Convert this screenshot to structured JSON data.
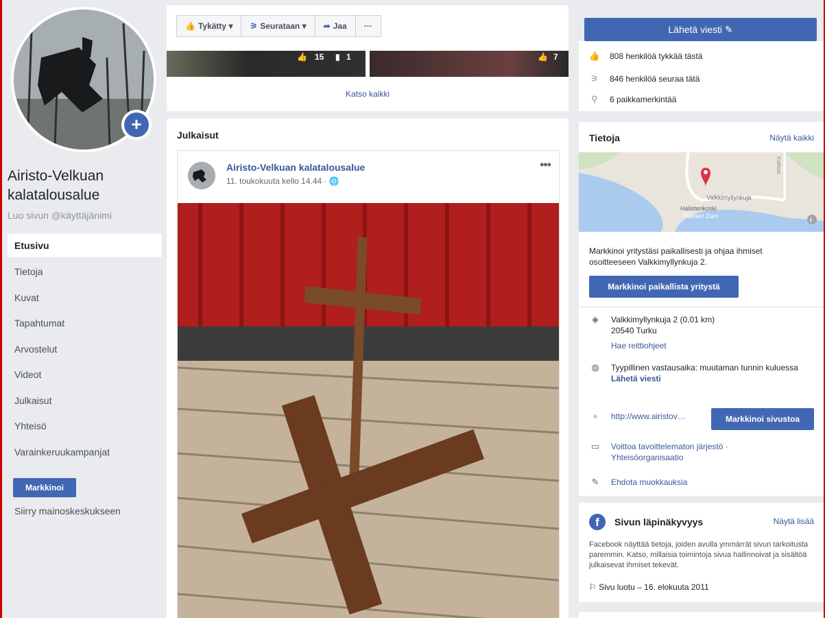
{
  "page": {
    "name": "Airisto-Velkuan kalatalousalue",
    "username_cta": "Luo sivun @käyttäjänimi"
  },
  "nav": {
    "items": [
      "Etusivu",
      "Tietoja",
      "Kuvat",
      "Tapahtumat",
      "Arvostelut",
      "Videot",
      "Julkaisut",
      "Yhteisö",
      "Varainkeruukampanjat"
    ],
    "active": "Etusivu",
    "promote_label": "Markkinoi",
    "ads_center_link": "Siirry mainoskeskukseen"
  },
  "actions": {
    "liked": "Tykätty",
    "following": "Seurataan",
    "share": "Jaa",
    "more": "···"
  },
  "photos": {
    "photo1_likes": "15",
    "photo1_comments": "1",
    "photo2_likes": "7",
    "see_all": "Katso kaikki"
  },
  "posts": {
    "title": "Julkaisut",
    "items": [
      {
        "author": "Airisto-Velkuan kalatalousalue",
        "time": "11. toukokuuta kello 14.44 ·",
        "more": "•••"
      }
    ]
  },
  "right": {
    "send_message": "Lähetä viesti",
    "stats": {
      "likes": "808 henkilöä tykkää tästä",
      "follows": "846 henkilöä seuraa tätä",
      "checkins": "6 paikkamerkintää"
    },
    "about": {
      "title": "Tietoja",
      "see_all": "Näytä kaikki",
      "map_labels": {
        "street": "Valkkimyllynkuja",
        "area1": "Halistenkoski",
        "area2": "Halinen Dam",
        "area3": "Kalliost"
      },
      "promote_text": "Markkinoi yritystäsi paikallisesti ja ohjaa ihmiset osoitteeseen Valkkimyllynkuja 2.",
      "promote_button": "Markkinoi paikallista yritystä",
      "address_line1": "Valkkimyllynkuja 2 (0,01 km)",
      "address_line2": "20540 Turku",
      "directions": "Hae reittiohjeet",
      "response_time": "Tyypillinen vastausaika: muutaman tunnin kuluessa",
      "send_message": "Lähetä viesti",
      "website": "http://www.airistov…",
      "website_button": "Markkinoi sivustoa",
      "category_line1": "Voittoa tavoittelematon järjestö ·",
      "category_line2": "Yhteisöorganisaatio",
      "suggest_edits": "Ehdota muokkauksia"
    },
    "transparency": {
      "title": "Sivun läpinäkyvyys",
      "see_more": "Näytä lisää",
      "text": "Facebook näyttää tietoja, joiden avulla ymmärrät sivun tarkoitusta paremmin. Katso, millaisia toimintoja sivua hallinnoivat ja sisältöä julkaisevat ihmiset tekevät.",
      "created": "Sivu luotu – 16. elokuuta 2011"
    }
  },
  "colors": {
    "accent": "#4267b2",
    "link": "#385898",
    "background": "#e9ebee"
  }
}
